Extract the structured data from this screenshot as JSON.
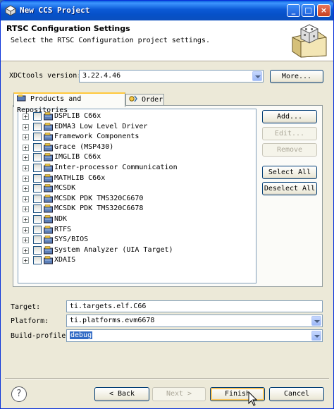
{
  "window": {
    "title": "New CCS Project"
  },
  "banner": {
    "title": "RTSC Configuration Settings",
    "description": "Select the RTSC Configuration project settings."
  },
  "xdc": {
    "label": "XDCtools version:",
    "value": "3.22.4.46",
    "more_button": "More..."
  },
  "tabs": [
    {
      "label": "Products and Repositories"
    },
    {
      "label": "Order"
    }
  ],
  "products": [
    {
      "label": "DSPLIB C66x"
    },
    {
      "label": "EDMA3 Low Level Driver"
    },
    {
      "label": "Framework Components"
    },
    {
      "label": "Grace (MSP430)"
    },
    {
      "label": "IMGLIB C66x"
    },
    {
      "label": "Inter-processor Communication"
    },
    {
      "label": "MATHLIB C66x"
    },
    {
      "label": "MCSDK"
    },
    {
      "label": "MCSDK PDK TMS320C6670"
    },
    {
      "label": "MCSDK PDK TMS320C6678"
    },
    {
      "label": "NDK"
    },
    {
      "label": "RTFS"
    },
    {
      "label": "SYS/BIOS"
    },
    {
      "label": "System Analyzer (UIA Target)"
    },
    {
      "label": "XDAIS"
    }
  ],
  "side_buttons": {
    "add": "Add...",
    "edit": "Edit...",
    "remove": "Remove",
    "select_all": "Select All",
    "deselect_all": "Deselect All"
  },
  "target": {
    "label": "Target:",
    "value": "ti.targets.elf.C66"
  },
  "platform": {
    "label": "Platform:",
    "value": "ti.platforms.evm6678"
  },
  "build_profile": {
    "label": "Build-profile:",
    "value": "debug"
  },
  "footer": {
    "help": "?",
    "back": "< Back",
    "next": "Next >",
    "finish": "Finish",
    "cancel": "Cancel"
  },
  "colors": {
    "titlebar": "#0b59d6",
    "dialog_bg": "#ece9d8",
    "selection": "#316ac5",
    "tab_highlight": "#ffc83c"
  },
  "icons": [
    "window-app-icon",
    "minimize-icon",
    "maximize-icon",
    "close-icon",
    "wizard-banner-icon",
    "package-icon",
    "order-icon",
    "help-icon",
    "mouse-pointer-icon"
  ]
}
